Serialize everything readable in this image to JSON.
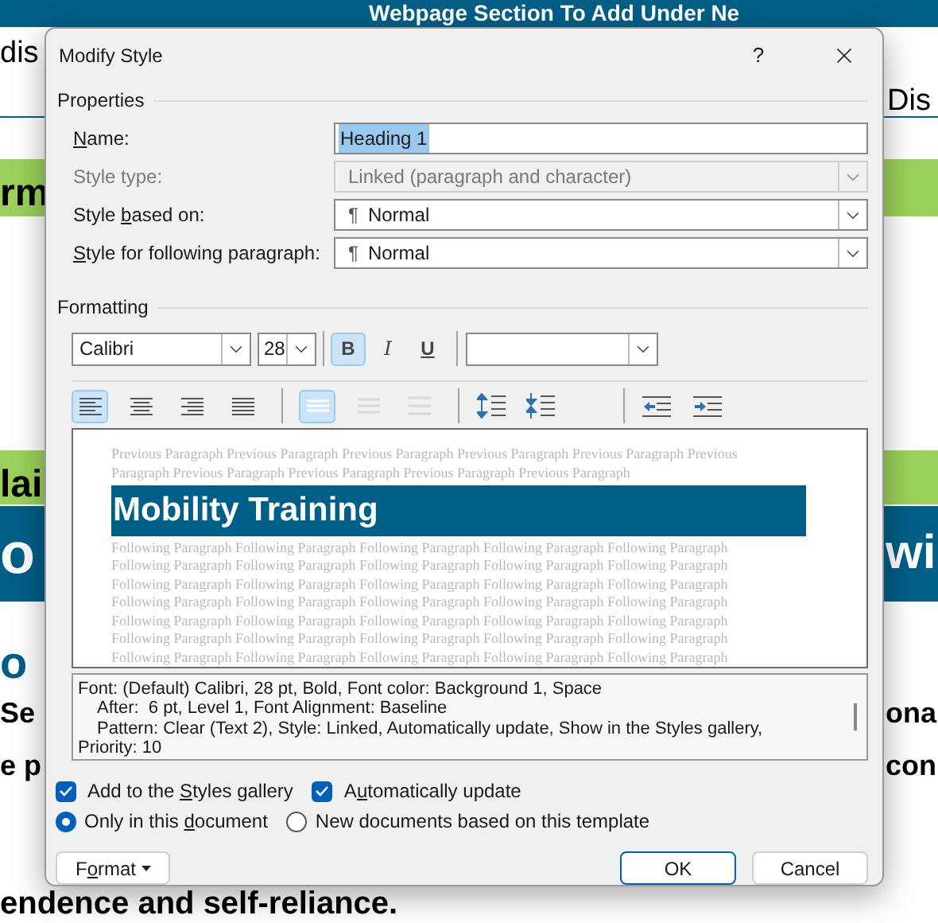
{
  "background_document": {
    "banner": "Webpage Section To Add Under Ne",
    "table_left": "dis",
    "table_right": "Dis",
    "green_left": "rm",
    "green_left_2": "lai",
    "blue_left": "o",
    "blue_right": "wi",
    "heading_left": "o",
    "body_lines": [
      {
        "left": "Se",
        "right": "ona"
      },
      {
        "left": "e p",
        "right": "con"
      }
    ],
    "last_line": "endence and self-reliance."
  },
  "dialog": {
    "title": "Modify Style",
    "help": "?",
    "properties": {
      "title": "Properties",
      "rows": [
        {
          "label": {
            "key": "N",
            "after": "ame:"
          },
          "kind": "text",
          "value": "Heading 1"
        },
        {
          "label": {
            "before": "Style type:"
          },
          "kind": "select",
          "value": "Linked (paragraph and character)",
          "disabled": true
        },
        {
          "label": {
            "before": "Style ",
            "key": "b",
            "after": "ased on:"
          },
          "kind": "select",
          "pilcrow": "¶",
          "value": "Normal",
          "disabled": false
        },
        {
          "label": {
            "key": "S",
            "after": "tyle for following paragraph:"
          },
          "kind": "select",
          "pilcrow": "¶",
          "value": "Normal",
          "disabled": false
        }
      ]
    },
    "formatting": {
      "title": "Formatting",
      "font": "Calibri",
      "size": "28",
      "styles": [
        {
          "kind": "bold",
          "label": "B",
          "selected": true
        },
        {
          "kind": "italic",
          "label": "I",
          "selected": false
        },
        {
          "kind": "underline",
          "label": "U",
          "selected": false
        }
      ],
      "alignment": [
        {
          "kind": "left",
          "selected": true
        },
        {
          "kind": "center",
          "selected": false
        },
        {
          "kind": "right",
          "selected": false
        },
        {
          "kind": "justify",
          "selected": false
        }
      ],
      "spacing": [
        {
          "kind": "single",
          "selected": true,
          "disabled": false
        },
        {
          "kind": "one-half",
          "selected": false,
          "disabled": true
        },
        {
          "kind": "double",
          "selected": false,
          "disabled": true
        }
      ],
      "paragraph_spacing": [
        {
          "kind": "increase"
        },
        {
          "kind": "decrease"
        }
      ],
      "indent": [
        {
          "kind": "decrease"
        },
        {
          "kind": "increase"
        }
      ]
    },
    "preview": {
      "previous_lines": [
        "Previous Paragraph Previous Paragraph Previous Paragraph Previous Paragraph Previous Paragraph Previous",
        "Paragraph Previous Paragraph Previous Paragraph Previous Paragraph Previous Paragraph"
      ],
      "heading": "Mobility Training",
      "following_lines": [
        "Following Paragraph Following Paragraph Following Paragraph Following Paragraph Following Paragraph",
        "Following Paragraph Following Paragraph Following Paragraph Following Paragraph Following Paragraph",
        "Following Paragraph Following Paragraph Following Paragraph Following Paragraph Following Paragraph",
        "Following Paragraph Following Paragraph Following Paragraph Following Paragraph Following Paragraph",
        "Following Paragraph Following Paragraph Following Paragraph Following Paragraph Following Paragraph",
        "Following Paragraph Following Paragraph Following Paragraph Following Paragraph Following Paragraph",
        "Following Paragraph Following Paragraph Following Paragraph Following Paragraph Following Paragraph"
      ]
    },
    "description": [
      {
        "text": "Font: (Default) Calibri, 28 pt, Bold, Font color: Background 1, Space",
        "indent": false
      },
      {
        "text": "After:  6 pt, Level 1, Font Alignment: Baseline",
        "indent": true
      },
      {
        "text": "Pattern: Clear (Text 2), Style: Linked, Automatically update, Show in the Styles gallery,",
        "indent": true
      },
      {
        "text": "Priority: 10",
        "indent": false
      }
    ],
    "checkboxes": [
      {
        "label": {
          "before": "Add to the ",
          "key": "S",
          "after": "tyles gallery"
        },
        "checked": true
      },
      {
        "label": {
          "before": "A",
          "key": "u",
          "after": "tomatically update"
        },
        "checked": true
      }
    ],
    "radios": [
      {
        "label": {
          "before": "Only in this ",
          "key": "d",
          "after": "ocument"
        },
        "selected": true
      },
      {
        "label": {
          "before": "New documents based on this template"
        },
        "selected": false
      }
    ],
    "buttons": [
      {
        "kind": "menu",
        "label": {
          "before": "F",
          "key": "o",
          "after": "rmat"
        }
      },
      {
        "kind": "default",
        "label": {
          "before": "OK"
        }
      },
      {
        "kind": "normal",
        "label": {
          "before": "Cancel"
        }
      }
    ]
  }
}
